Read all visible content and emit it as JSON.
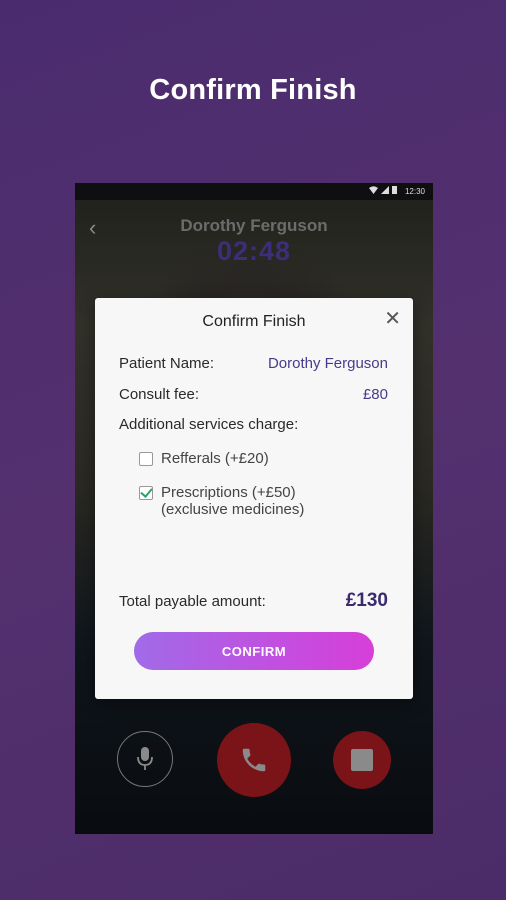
{
  "promo": {
    "title": "Confirm Finish"
  },
  "statusbar": {
    "time": "12:30"
  },
  "call": {
    "caller_name": "Dorothy Ferguson",
    "timer": "02:48"
  },
  "dialog": {
    "title": "Confirm Finish",
    "patient_label": "Patient Name:",
    "patient_value": "Dorothy Ferguson",
    "fee_label": "Consult fee:",
    "fee_value": "£80",
    "additional_label": "Additional services charge:",
    "options": [
      {
        "label": "Refferals (+£20)",
        "checked": false
      },
      {
        "label": "Prescriptions (+£50)",
        "sublabel": "(exclusive medicines)",
        "checked": true
      }
    ],
    "total_label": "Total payable amount:",
    "total_value": "£130",
    "confirm_label": "CONFIRM"
  },
  "colors": {
    "background": "#4f2d6d",
    "accent_start": "#a06be8",
    "accent_end": "#d63fd8",
    "value_text": "#4a3a8a",
    "check": "#2ea36a"
  }
}
